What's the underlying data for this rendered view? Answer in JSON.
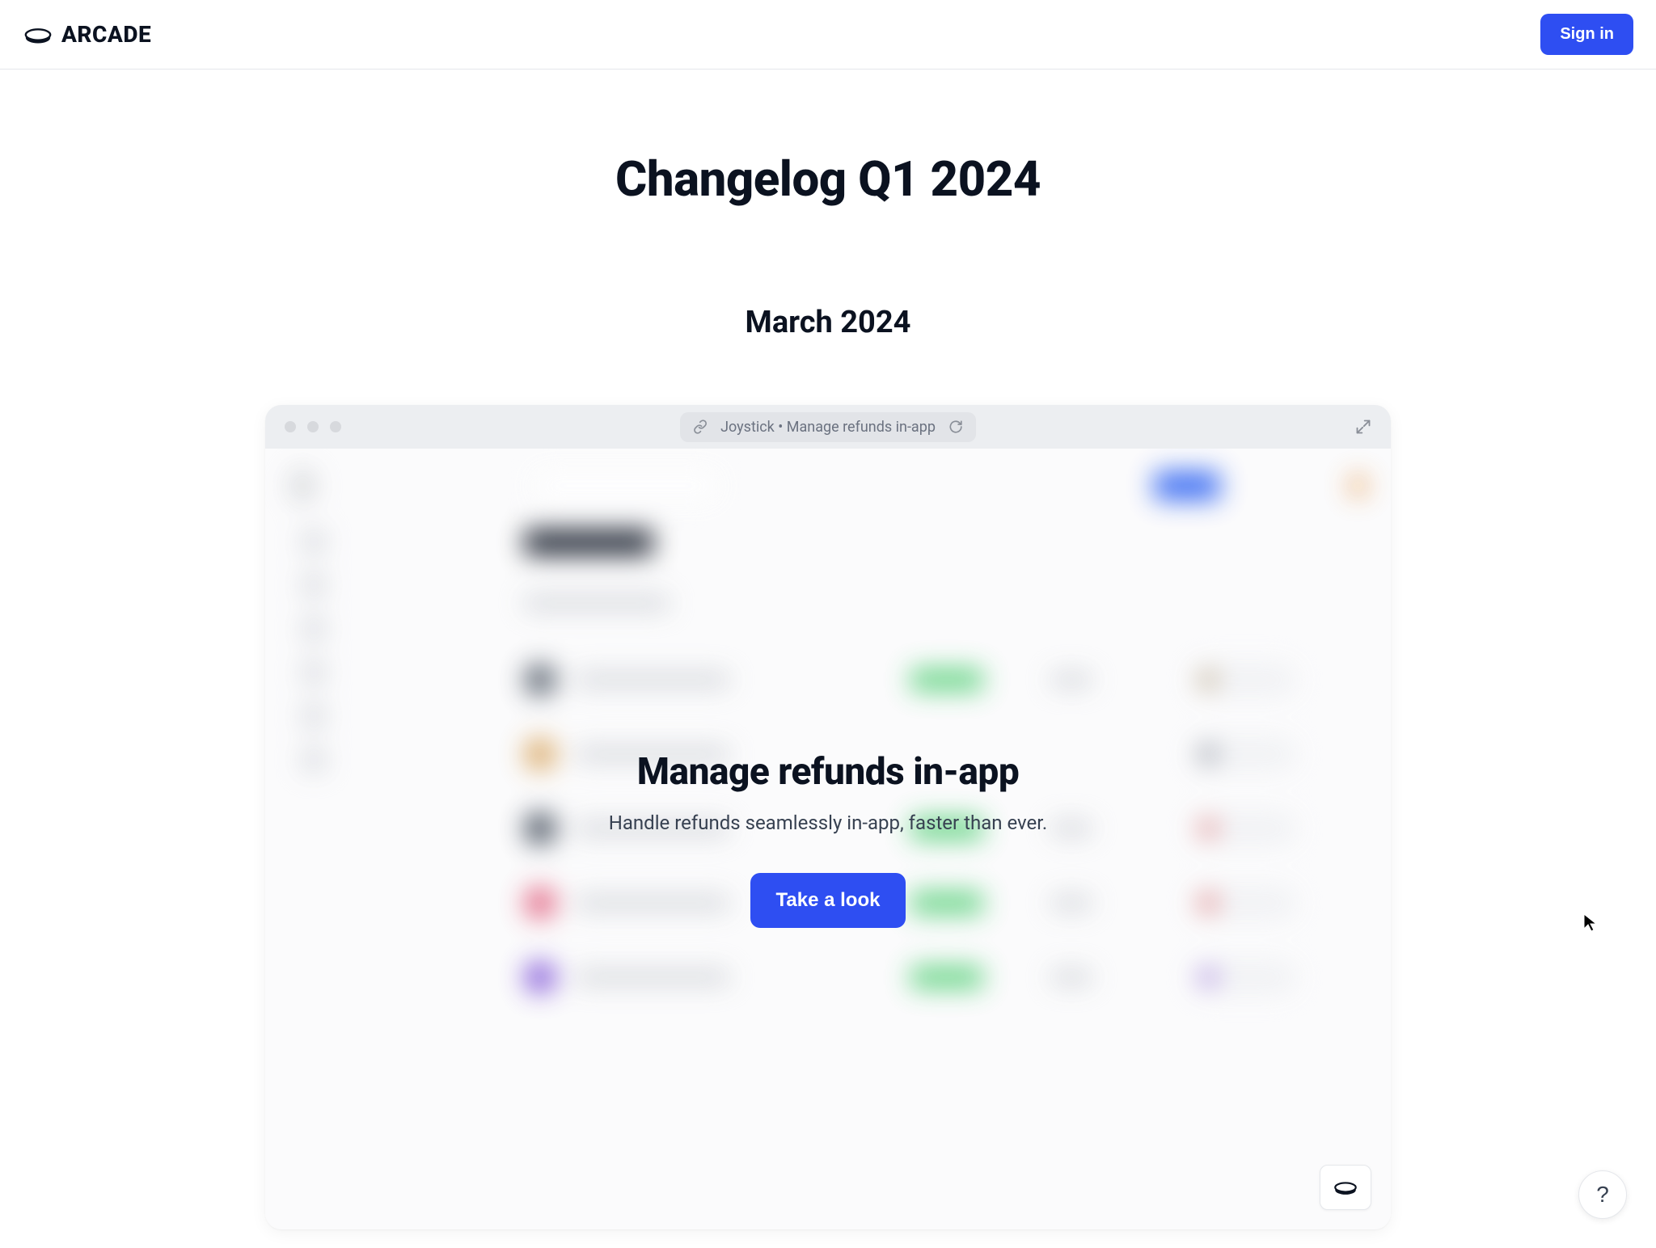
{
  "header": {
    "brand_name": "ARCADE",
    "sign_in_label": "Sign in"
  },
  "page": {
    "title": "Changelog Q1 2024",
    "month": "March 2024"
  },
  "arcade_frame": {
    "url_text": "Joystick • Manage refunds in-app",
    "overlay": {
      "title": "Manage refunds in-app",
      "subtitle": "Handle refunds seamlessly in-app, faster than ever.",
      "cta_label": "Take a look"
    }
  },
  "help_button": {
    "label": "?"
  },
  "icons": {
    "link": "link-icon",
    "refresh": "refresh-icon",
    "expand": "expand-icon",
    "logo": "arcade-logo-icon"
  },
  "colors": {
    "accent": "#2e4ef2",
    "text": "#0b1220",
    "chrome": "#eceef1",
    "pill": "#e2e4e8"
  }
}
